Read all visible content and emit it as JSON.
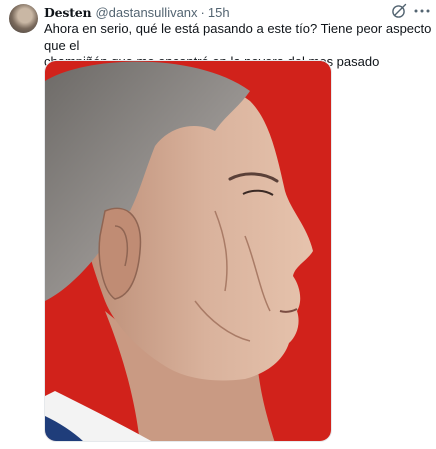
{
  "tweet": {
    "display_name": "Desten",
    "handle": "@dastansullivanx",
    "separator": "·",
    "time": "15h",
    "text": "Ahora en serio, qué le está pasando a este tío? Tiene peor aspecto que el\nchampiñón que me encontré en la nevera del mes pasado"
  },
  "icons": {
    "grok": "grok-icon",
    "more": "more-icon"
  },
  "colors": {
    "text": "#0f1419",
    "secondary": "#536471",
    "photo_background_red": "#d1221b"
  }
}
